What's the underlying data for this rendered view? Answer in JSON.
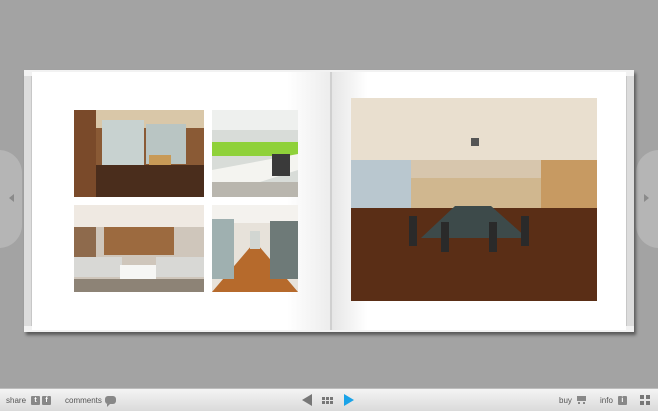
{
  "toolbar": {
    "share_label": "share",
    "share_twitter_glyph": "t",
    "share_facebook_glyph": "f",
    "comments_label": "comments",
    "buy_label": "buy",
    "info_label": "info",
    "info_glyph": "i"
  },
  "icons": {
    "prev": "prev-arrow-icon",
    "grid": "thumbnail-grid-icon",
    "next": "next-arrow-icon",
    "cart": "cart-icon",
    "fullscreen": "fullscreen-icon"
  },
  "colors": {
    "background": "#a3a3a3",
    "next_accent": "#1aa3e8",
    "page": "#ffffff"
  },
  "book": {
    "left_page_photos": [
      "reception-lounge",
      "open-office-green-desks",
      "lounge-sofas",
      "corridor"
    ],
    "right_page_photos": [
      "boardroom"
    ]
  }
}
